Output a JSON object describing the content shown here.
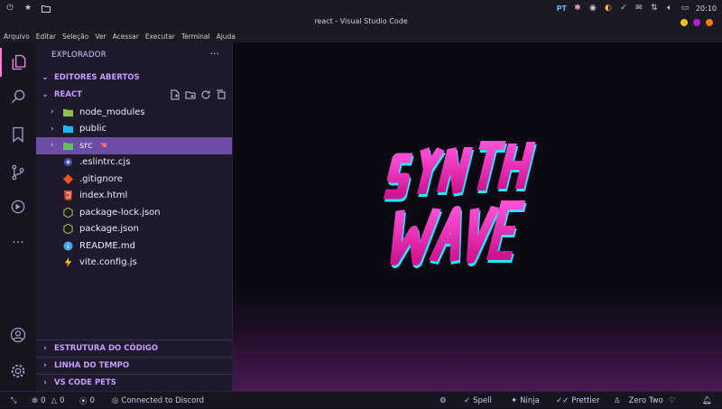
{
  "os": {
    "lang": "PT",
    "clock": "20:10"
  },
  "window": {
    "title": "react - Visual Studio Code"
  },
  "menu": [
    "Arquivo",
    "Editar",
    "Seleção",
    "Ver",
    "Acessar",
    "Executar",
    "Terminal",
    "Ajuda"
  ],
  "sidebar": {
    "title": "EXPLORADOR",
    "more": "···",
    "open_editors": "EDITORES ABERTOS",
    "folder": "REACT",
    "items": [
      {
        "label": "node_modules",
        "chev": "›",
        "icon": "folder-node-icon"
      },
      {
        "label": "public",
        "chev": "›",
        "icon": "folder-public-icon"
      },
      {
        "label": "src",
        "chev": "›",
        "icon": "folder-src-icon",
        "selected": true
      },
      {
        "label": ".eslintrc.cjs",
        "icon": "eslint-icon"
      },
      {
        "label": ".gitignore",
        "icon": "git-icon"
      },
      {
        "label": "index.html",
        "icon": "html-icon"
      },
      {
        "label": "package-lock.json",
        "icon": "node-icon"
      },
      {
        "label": "package.json",
        "icon": "node-icon"
      },
      {
        "label": "README.md",
        "icon": "info-icon"
      },
      {
        "label": "vite.config.js",
        "icon": "vite-icon"
      }
    ],
    "bottom_sections": [
      "ESTRUTURA DO CÓDIGO",
      "LINHA DO TEMPO",
      "VS CODE PETS"
    ]
  },
  "status": {
    "errors": "0",
    "warnings": "0",
    "ports": "0",
    "discord": "Connected to Discord",
    "spell": "Spell",
    "ninja": "Ninja",
    "prettier": "Prettier",
    "theme": "Zero Two"
  },
  "colors": {
    "accent": "#ff7edb",
    "selection": "#6b4ea3",
    "section": "#c89cff"
  }
}
